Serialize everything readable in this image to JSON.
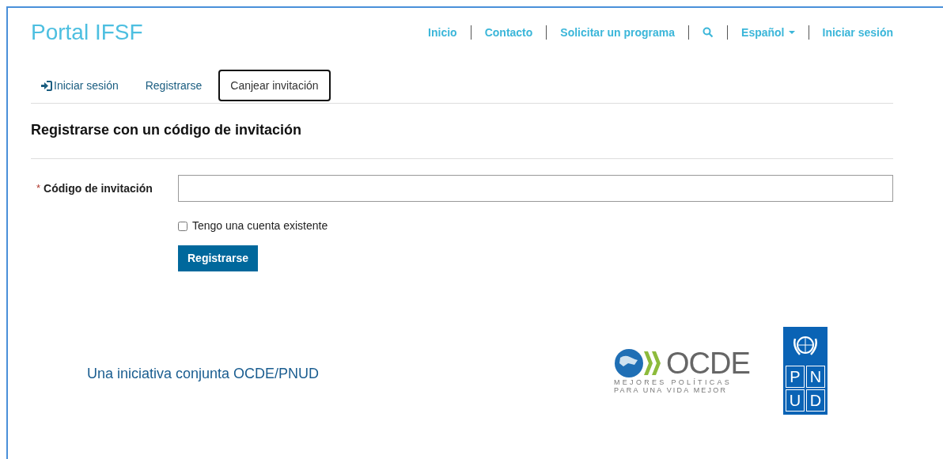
{
  "brand": "Portal IFSF",
  "nav": [
    {
      "kind": "link",
      "label": "Inicio"
    },
    {
      "kind": "link",
      "label": "Contacto"
    },
    {
      "kind": "link",
      "label": "Solicitar un programa"
    },
    {
      "kind": "search"
    },
    {
      "kind": "dropdown",
      "label": "Español"
    },
    {
      "kind": "link",
      "label": "Iniciar sesión"
    }
  ],
  "tabs": [
    {
      "kind": "with-icon",
      "label": "Iniciar sesión",
      "selected": false
    },
    {
      "kind": "plain",
      "label": "Registrarse",
      "selected": false
    },
    {
      "kind": "plain",
      "label": "Canjear invitación",
      "selected": true
    }
  ],
  "heading": "Registrarse con un código de invitación",
  "form": {
    "required_mark": "*",
    "label": "Código de invitación",
    "checkbox": {
      "label": "Tengo una cuenta existente",
      "checked": false
    },
    "submit": "Registrarse"
  },
  "footer": {
    "text": "Una iniciativa conjunta OCDE/PNUD",
    "ocde_logo": {
      "name": "OCDE",
      "tagline_1": "MEJORES POLÍTICAS",
      "tagline_2": "PARA UNA VIDA MEJOR"
    },
    "pnud_logo": {
      "letters": [
        "P",
        "N",
        "U",
        "D"
      ]
    }
  }
}
